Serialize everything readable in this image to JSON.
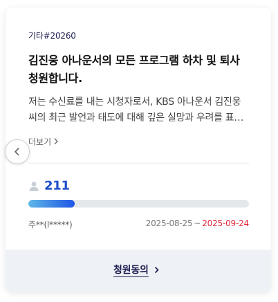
{
  "petition": {
    "category": "기타#20260",
    "title": "김진웅 아나운서의 모든 프로그램 하차 및 퇴사 청원합니다.",
    "summary": "저는 수신료를 내는 시청자로서, KBS 아나운서 김진웅 씨의 최근 발언과 태도에 대해 깊은 실망과 우려를 표합니다.",
    "more_label": "더보기",
    "count": "211",
    "progress_fraction": 0.21,
    "author": "주**(l*****)",
    "date_start": "2025-08-25",
    "date_separator": "~",
    "date_end": "2025-09-24"
  },
  "footer": {
    "agree_label": "청원동의"
  },
  "icons": {
    "prev": "chevron-left-icon",
    "more": "chevron-right-icon",
    "person": "person-icon",
    "agree": "chevron-right-icon"
  },
  "colors": {
    "accent": "#1d4ec9",
    "end_date": "#e0283a",
    "footer_bg": "#eef2f6",
    "progress_start": "#5fb8e6",
    "progress_end": "#1f55e6"
  }
}
